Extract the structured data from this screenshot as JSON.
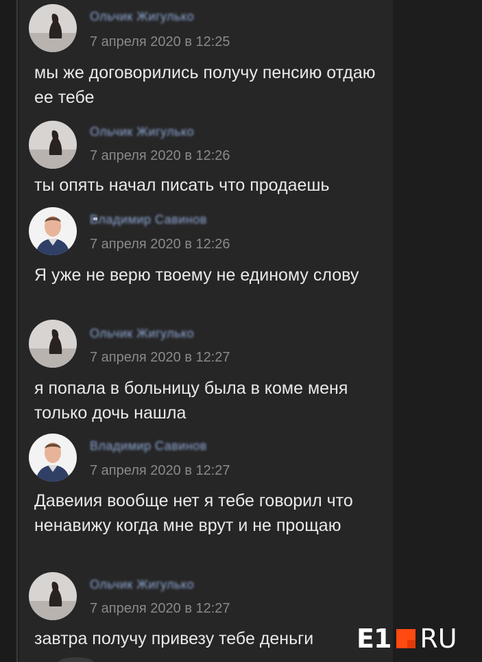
{
  "messages": [
    {
      "author": "Ольчик Жигулько",
      "avatar": "avatar-woman",
      "time": "7 апреля 2020 в 12:25",
      "text": "мы же договорились получу пенсию отдаю ее тебе"
    },
    {
      "author": "Ольчик Жигулько",
      "avatar": "avatar-woman",
      "time": "7 апреля 2020 в 12:26",
      "text": "ты опять начал писать что продаешь"
    },
    {
      "author": "Владимир Савинов",
      "avatar": "avatar-man",
      "time": "7 апреля 2020 в 12:26",
      "text": "Я уже не верю твоему не единому слову"
    },
    {
      "author": "Ольчик Жигулько",
      "avatar": "avatar-woman",
      "time": "7 апреля 2020 в 12:27",
      "text": "я попала в больницу была в коме меня только дочь нашла"
    },
    {
      "author": "Владимир Савинов",
      "avatar": "avatar-man",
      "time": "7 апреля 2020 в 12:27",
      "text": "Давеиия вообще нет я тебе говорил что ненавижу когда мне врут и не прощаю"
    },
    {
      "author": "Ольчик Жигулько",
      "avatar": "avatar-woman",
      "time": "7 апреля 2020 в 12:27",
      "text": "завтра получу привезу тебе деньги"
    }
  ],
  "watermark": {
    "left": "E1",
    "right": "RU",
    "accent_color": "#ff4a12"
  },
  "colors": {
    "background": "#262627",
    "author": "#8fa9d6",
    "time": "#8a8a8c",
    "text": "#e9e9e9"
  }
}
